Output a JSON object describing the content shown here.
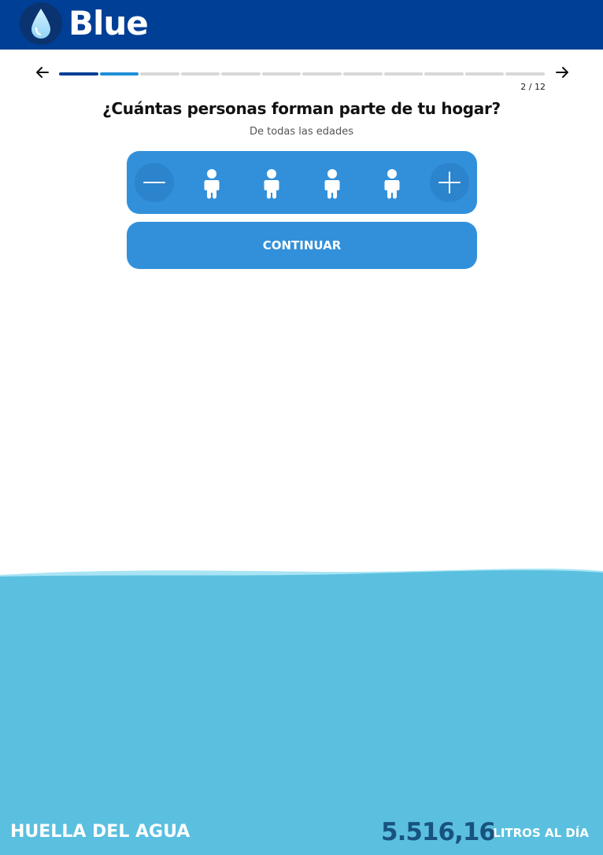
{
  "header": {
    "logo_icon": "water-drop-icon",
    "title": "Blue",
    "bg_color": "#003f96"
  },
  "navigation": {
    "prev_icon": "arrow-left-icon",
    "next_icon": "arrow-right-icon"
  },
  "progress": {
    "total_steps": 12,
    "current_step": 2,
    "counter_text": "2 / 12",
    "completed_color": "#003f96",
    "current_color": "#1e8fd8",
    "pending_color": "#d8d8d8"
  },
  "question": {
    "title": "¿Cuántas personas forman parte de tu hogar?",
    "subtitle": "De todas las edades"
  },
  "household": {
    "decrement_icon": "minus-icon",
    "increment_icon": "plus-icon",
    "person_icon": "person-icon",
    "people_count": 4,
    "accent_color": "#3290da"
  },
  "actions": {
    "continue_label": "CONTINUAR"
  },
  "footer": {
    "label": "HUELLA DEL AGUA",
    "value": "5.516,16",
    "unit": "LITROS AL DÍA",
    "water_color": "#5bc0df"
  }
}
